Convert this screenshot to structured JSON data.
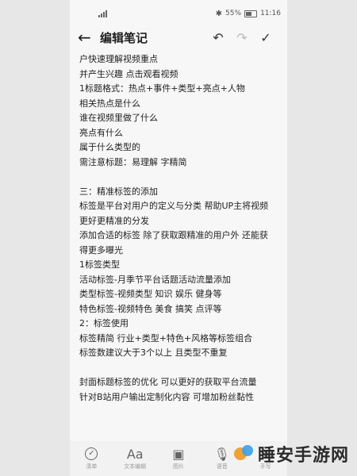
{
  "statusbar": {
    "left": "⁵⁶ᵢₗ",
    "right_text": "55%",
    "time": "11:16"
  },
  "header": {
    "title": "编辑笔记",
    "back_icon": "arrow-left-icon",
    "undo_icon": "undo-icon",
    "redo_icon": "redo-icon",
    "done_icon": "checkmark-icon"
  },
  "content": {
    "lines": [
      "户快速理解视频重点",
      "并产生兴趣 点击观看视频",
      "1标题格式：热点+事件+类型+亮点+人物",
      "相关热点是什么",
      "谁在视频里做了什么",
      "亮点有什么",
      "属于什么类型的",
      "需注意标题：易理解 字精简",
      "",
      "三：精准标签的添加",
      "标签是平台对用户的定义与分类 帮助UP主将视频",
      "更好更精准的分发",
      "添加合适的标签 除了获取跟精准的用户外 还能获",
      "得更多曝光",
      "1标签类型",
      "活动标签-月季节平台话题活动流量添加",
      "类型标签-视频类型 知识 娱乐 健身等",
      "特色标签-视频特色 美食 搞笑 点评等",
      "2：标签使用",
      "标签精简 行业+类型+特色+风格等标签组合",
      "标签数建议大于3个以上 且类型不重复",
      "",
      "封面标题标签的优化 可以更好的获取平台流量",
      "针对B站用户输出定制化内容 可增加粉丝黏性"
    ]
  },
  "bottombar": {
    "items": [
      {
        "label": "清单",
        "icon": "check-circle-icon"
      },
      {
        "label": "文本编辑",
        "icon": "text-format-icon"
      },
      {
        "label": "图片",
        "icon": "image-icon"
      },
      {
        "label": "语音",
        "icon": "microphone-icon"
      },
      {
        "label": "手写",
        "icon": "handwriting-icon"
      }
    ]
  },
  "watermark": {
    "text": "睡安手游网"
  }
}
